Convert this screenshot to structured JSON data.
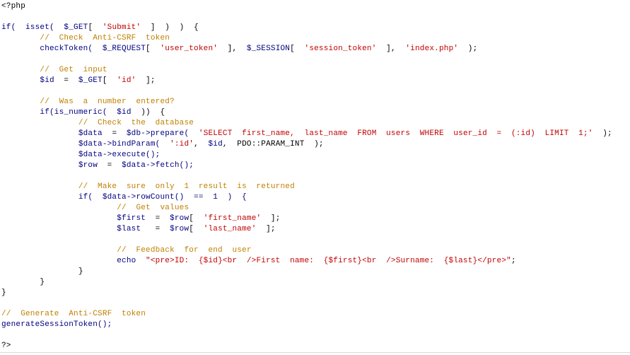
{
  "editor": {
    "language": "php",
    "theme": {
      "background": "#ffffff",
      "default_text": "#000000",
      "variable": "#000080",
      "string": "#c00000",
      "comment": "#c08000"
    },
    "lines": [
      [
        {
          "t": "<?php",
          "c": "op"
        }
      ],
      [],
      [
        {
          "t": "if(  isset(  ",
          "c": "fn"
        },
        {
          "t": "$_GET",
          "c": "var"
        },
        {
          "t": "[  ",
          "c": "op"
        },
        {
          "t": "'Submit'",
          "c": "str"
        },
        {
          "t": "  ]  )  )  {",
          "c": "op"
        }
      ],
      [
        {
          "t": "        ",
          "c": "op"
        },
        {
          "t": "//  Check  Anti-CSRF  token",
          "c": "comment"
        }
      ],
      [
        {
          "t": "        checkToken(  ",
          "c": "fn"
        },
        {
          "t": "$_REQUEST",
          "c": "var"
        },
        {
          "t": "[  ",
          "c": "op"
        },
        {
          "t": "'user_token'",
          "c": "str"
        },
        {
          "t": "  ],  ",
          "c": "op"
        },
        {
          "t": "$_SESSION",
          "c": "var"
        },
        {
          "t": "[  ",
          "c": "op"
        },
        {
          "t": "'session_token'",
          "c": "str"
        },
        {
          "t": "  ],  ",
          "c": "op"
        },
        {
          "t": "'index.php'",
          "c": "str"
        },
        {
          "t": "  );",
          "c": "op"
        }
      ],
      [],
      [
        {
          "t": "        ",
          "c": "op"
        },
        {
          "t": "//  Get  input",
          "c": "comment"
        }
      ],
      [
        {
          "t": "        ",
          "c": "op"
        },
        {
          "t": "$id",
          "c": "var"
        },
        {
          "t": "  =  ",
          "c": "op"
        },
        {
          "t": "$_GET",
          "c": "var"
        },
        {
          "t": "[  ",
          "c": "op"
        },
        {
          "t": "'id'",
          "c": "str"
        },
        {
          "t": "  ];",
          "c": "op"
        }
      ],
      [],
      [
        {
          "t": "        ",
          "c": "op"
        },
        {
          "t": "//  Was  a  number  entered?",
          "c": "comment"
        }
      ],
      [
        {
          "t": "        if(is_numeric(  ",
          "c": "fn"
        },
        {
          "t": "$id",
          "c": "var"
        },
        {
          "t": "  ))  {",
          "c": "op"
        }
      ],
      [
        {
          "t": "                ",
          "c": "op"
        },
        {
          "t": "//  Check  the  database",
          "c": "comment"
        }
      ],
      [
        {
          "t": "                ",
          "c": "op"
        },
        {
          "t": "$data",
          "c": "var"
        },
        {
          "t": "  =  ",
          "c": "op"
        },
        {
          "t": "$db",
          "c": "var"
        },
        {
          "t": "->prepare(  ",
          "c": "fn"
        },
        {
          "t": "'SELECT  first_name,  last_name  FROM  users  WHERE  user_id  =  (:id)  LIMIT  1;'",
          "c": "str"
        },
        {
          "t": "  );",
          "c": "op"
        }
      ],
      [
        {
          "t": "                ",
          "c": "op"
        },
        {
          "t": "$data",
          "c": "var"
        },
        {
          "t": "->bindParam(  ",
          "c": "fn"
        },
        {
          "t": "':id'",
          "c": "str"
        },
        {
          "t": ",  ",
          "c": "op"
        },
        {
          "t": "$id",
          "c": "var"
        },
        {
          "t": ",  PDO::PARAM_INT  );",
          "c": "op"
        }
      ],
      [
        {
          "t": "                ",
          "c": "op"
        },
        {
          "t": "$data",
          "c": "var"
        },
        {
          "t": "->execute();",
          "c": "fn"
        }
      ],
      [
        {
          "t": "                ",
          "c": "op"
        },
        {
          "t": "$row",
          "c": "var"
        },
        {
          "t": "  =  ",
          "c": "op"
        },
        {
          "t": "$data",
          "c": "var"
        },
        {
          "t": "->fetch();",
          "c": "fn"
        }
      ],
      [],
      [
        {
          "t": "                ",
          "c": "op"
        },
        {
          "t": "//  Make  sure  only  1  result  is  returned",
          "c": "comment"
        }
      ],
      [
        {
          "t": "                if(  ",
          "c": "fn"
        },
        {
          "t": "$data",
          "c": "var"
        },
        {
          "t": "->rowCount()  ==  1  )  {",
          "c": "fn"
        }
      ],
      [
        {
          "t": "                        ",
          "c": "op"
        },
        {
          "t": "//  Get  values",
          "c": "comment"
        }
      ],
      [
        {
          "t": "                        ",
          "c": "op"
        },
        {
          "t": "$first",
          "c": "var"
        },
        {
          "t": "  =  ",
          "c": "op"
        },
        {
          "t": "$row",
          "c": "var"
        },
        {
          "t": "[  ",
          "c": "op"
        },
        {
          "t": "'first_name'",
          "c": "str"
        },
        {
          "t": "  ];",
          "c": "op"
        }
      ],
      [
        {
          "t": "                        ",
          "c": "op"
        },
        {
          "t": "$last",
          "c": "var"
        },
        {
          "t": "   =  ",
          "c": "op"
        },
        {
          "t": "$row",
          "c": "var"
        },
        {
          "t": "[  ",
          "c": "op"
        },
        {
          "t": "'last_name'",
          "c": "str"
        },
        {
          "t": "  ];",
          "c": "op"
        }
      ],
      [],
      [
        {
          "t": "                        ",
          "c": "op"
        },
        {
          "t": "//  Feedback  for  end  user",
          "c": "comment"
        }
      ],
      [
        {
          "t": "                        echo  ",
          "c": "fn"
        },
        {
          "t": "\"<pre>ID:  {$id}<br  />First  name:  {$first}<br  />Surname:  {$last}</pre>\"",
          "c": "str"
        },
        {
          "t": ";",
          "c": "op"
        }
      ],
      [
        {
          "t": "                }",
          "c": "op"
        }
      ],
      [
        {
          "t": "        }",
          "c": "op"
        }
      ],
      [
        {
          "t": "}",
          "c": "op"
        }
      ],
      [],
      [
        {
          "t": "//  Generate  Anti-CSRF  token",
          "c": "comment"
        }
      ],
      [
        {
          "t": "generateSessionToken();",
          "c": "fn"
        }
      ],
      [],
      [
        {
          "t": "?>",
          "c": "op"
        }
      ]
    ]
  }
}
